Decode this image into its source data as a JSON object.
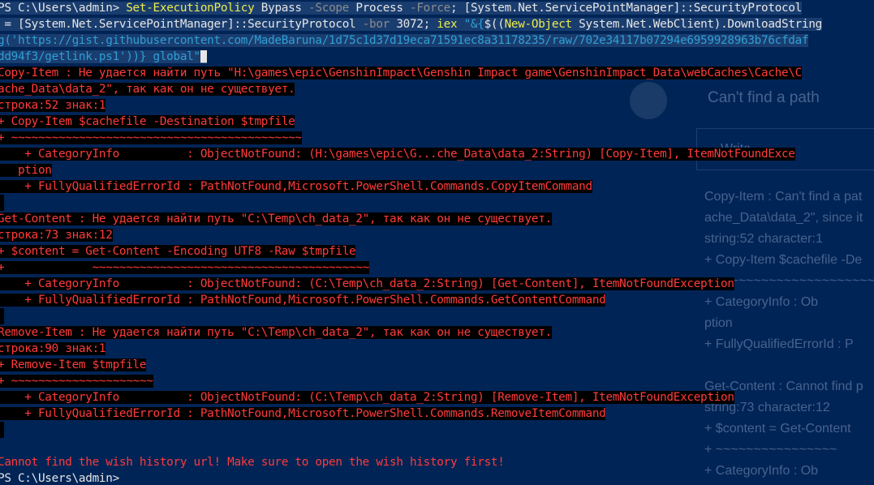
{
  "window": {
    "type": "PowerShell console"
  },
  "colors": {
    "background": "#012456",
    "text": "#e6e6e6",
    "cmdlet": "#ecec4c",
    "parameter": "#8c8c8c",
    "string": "#2f9fd6",
    "variable": "#6cc36c",
    "error_text": "#ff3b3b",
    "error_background": "#000000"
  },
  "overlay": {
    "title": "Can't find a path",
    "input_placeholder": "Write",
    "lines": [
      "Copy-Item : Can't find a pat",
      "ache_Data\\data_2\", since it",
      "string:52 character:1",
      "+ Copy-Item $cachefile -De",
      "+ ~~~~~~~~~~~~~~~~~~~~~~",
      "    + CategoryInfo          : Ob",
      "  ption",
      "    + FullyQualifiedErrorId : P",
      "",
      "Get-Content : Cannot find p",
      "string:73 character:12",
      "+ $content = Get-Content",
      "+             ~~~~~~~~~~~~~~~~",
      "    + CategoryInfo          : Ob"
    ]
  },
  "console": {
    "lines": [
      {
        "segments": [
          {
            "t": "PS C:\\Users\\admin> ",
            "c": "w"
          },
          {
            "t": "Set-ExecutionPolicy",
            "c": "y"
          },
          {
            "t": " Bypass ",
            "c": "w"
          },
          {
            "t": "-Scope",
            "c": "g"
          },
          {
            "t": " Process ",
            "c": "w"
          },
          {
            "t": "-Force",
            "c": "g"
          },
          {
            "t": "; [System.Net.ServicePointManager]::SecurityProtocol",
            "c": "w"
          }
        ]
      },
      {
        "segments": [
          {
            "t": " = [System.Net.ServicePointManager]::SecurityProtocol ",
            "c": "w"
          },
          {
            "t": "-bor",
            "c": "g"
          },
          {
            "t": " 3072; ",
            "c": "w"
          },
          {
            "t": "iex",
            "c": "y"
          },
          {
            "t": " \"&{",
            "c": "url"
          },
          {
            "t": "$((",
            "c": "w"
          },
          {
            "t": "New-Object",
            "c": "y"
          },
          {
            "t": " System.Net.WebClient).DownloadString",
            "c": "w"
          }
        ]
      },
      {
        "segments": [
          {
            "t": "g('https://gist.githubusercontent.com/MadeBaruna/1d75c1d37d19eca71591ec8a31178235/raw/702e34117b07294e6959928963b76cfdaf",
            "c": "url"
          }
        ]
      },
      {
        "segments": [
          {
            "t": "dd94f3/getlink.ps1'))} global\"",
            "c": "url"
          },
          {
            "t": "_",
            "c": "cur"
          }
        ]
      },
      {
        "err": "Copy-Item : Не удается найти путь \"H:\\games\\epic\\GenshinImpact\\Genshin Impact game\\GenshinImpact_Data\\webCaches\\Cache\\C"
      },
      {
        "err": "ache_Data\\data_2\", так как он не существует."
      },
      {
        "err": "строка:52 знак:1"
      },
      {
        "err": "+ Copy-Item $cachefile -Destination $tmpfile"
      },
      {
        "err": "+ ~~~~~~~~~~~~~~~~~~~~~~~~~~~~~~~~~~~~~~~~~~~"
      },
      {
        "err": "    + CategoryInfo          : ObjectNotFound: (H:\\games\\epic\\G...che_Data\\data_2:String) [Copy-Item], ItemNotFoundExce"
      },
      {
        "err": "   ption"
      },
      {
        "err": "    + FullyQualifiedErrorId : PathNotFound,Microsoft.PowerShell.Commands.CopyItemCommand"
      },
      {
        "err": "",
        "tail": true
      },
      {
        "err": "Get-Content : Не удается найти путь \"C:\\Temp\\ch_data_2\", так как он не существует."
      },
      {
        "err": "строка:73 знак:12"
      },
      {
        "err": "+ $content = Get-Content -Encoding UTF8 -Raw $tmpfile"
      },
      {
        "err": "+             ~~~~~~~~~~~~~~~~~~~~~~~~~~~~~~~~~~~~~~~~~"
      },
      {
        "err": "    + CategoryInfo          : ObjectNotFound: (C:\\Temp\\ch_data_2:String) [Get-Content], ItemNotFoundException"
      },
      {
        "err": "    + FullyQualifiedErrorId : PathNotFound,Microsoft.PowerShell.Commands.GetContentCommand"
      },
      {
        "err": "",
        "tail": true
      },
      {
        "err": "Remove-Item : Не удается найти путь \"C:\\Temp\\ch_data_2\", так как он не существует."
      },
      {
        "err": "строка:90 знак:1"
      },
      {
        "err": "+ Remove-Item $tmpfile"
      },
      {
        "err": "+ ~~~~~~~~~~~~~~~~~~~~~"
      },
      {
        "err": "    + CategoryInfo          : ObjectNotFound: (C:\\Temp\\ch_data_2:String) [Remove-Item], ItemNotFoundException"
      },
      {
        "err": "    + FullyQualifiedErrorId : PathNotFound,Microsoft.PowerShell.Commands.RemoveItemCommand"
      },
      {
        "err": "",
        "tail": true
      },
      {
        "blank": true
      },
      {
        "plainerr": "Cannot find the wish history url! Make sure to open the wish history first!"
      },
      {
        "segments": [
          {
            "t": "PS C:\\Users\\admin>",
            "c": "w"
          }
        ]
      }
    ]
  }
}
